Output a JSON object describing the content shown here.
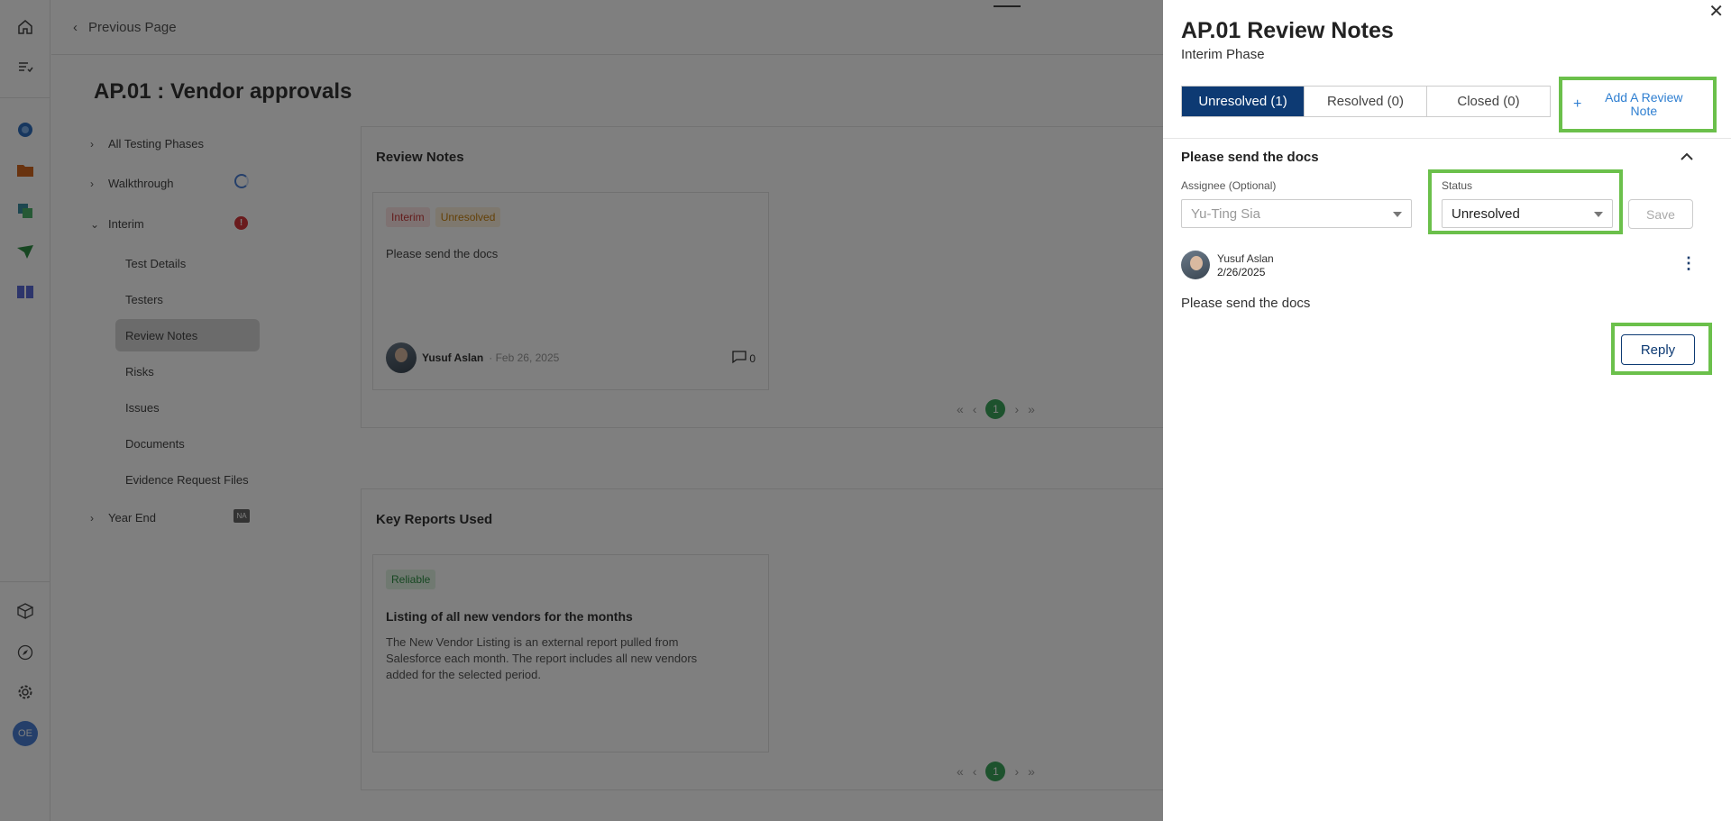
{
  "nav": {
    "previous_page": "Previous Page",
    "page_title": "AP.01 : Vendor approvals",
    "avatar_initials": "OE"
  },
  "tree": {
    "items": [
      {
        "label": "All Testing Phases"
      },
      {
        "label": "Walkthrough"
      },
      {
        "label": "Interim",
        "badge": "!"
      },
      {
        "label": "Year End",
        "badge": "NA"
      }
    ],
    "sub_items": [
      {
        "label": "Test Details"
      },
      {
        "label": "Testers"
      },
      {
        "label": "Review Notes"
      },
      {
        "label": "Risks"
      },
      {
        "label": "Issues"
      },
      {
        "label": "Documents"
      },
      {
        "label": "Evidence Request Files"
      }
    ]
  },
  "review_notes_panel": {
    "title": "Review Notes",
    "card": {
      "tag_phase": "Interim",
      "tag_status": "Unresolved",
      "text": "Please send the docs",
      "author": "Yusuf Aslan",
      "date": "· Feb 26, 2025",
      "comment_count": "0"
    },
    "page": "1"
  },
  "key_reports_panel": {
    "title": "Key Reports Used",
    "card": {
      "tag": "Reliable",
      "heading": "Listing of all new vendors for the months",
      "text": "The New Vendor Listing is an external report pulled from Salesforce each month. The report includes all new vendors added for the selected period."
    },
    "page": "1"
  },
  "drawer": {
    "title": "AP.01 Review Notes",
    "subtitle": "Interim Phase",
    "tabs": [
      {
        "label": "Unresolved (1)",
        "active": true
      },
      {
        "label": "Resolved (0)"
      },
      {
        "label": "Closed (0)"
      }
    ],
    "add_note_label": "Add A Review Note",
    "note": {
      "title": "Please send the docs",
      "assignee_label": "Assignee (Optional)",
      "assignee_value": "Yu-Ting Sia",
      "status_label": "Status",
      "status_value": "Unresolved",
      "save_label": "Save",
      "comment": {
        "author": "Yusuf Aslan",
        "date": "2/26/2025",
        "body": "Please send the docs"
      },
      "reply_label": "Reply"
    }
  },
  "colors": {
    "primary": "#0d3a73",
    "highlight": "#6bc04b",
    "link": "#2f7fd1"
  }
}
